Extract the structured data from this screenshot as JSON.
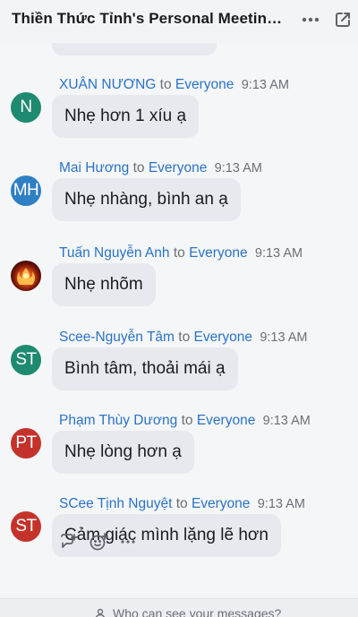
{
  "header": {
    "title": "Thiền Thức Tỉnh's Personal Meeting Room",
    "more_icon": "more-horizontal-icon",
    "popout_icon": "pop-out-icon"
  },
  "messages": [
    {
      "sender": "XUÂN NƯƠNG",
      "to": "to",
      "recipient": "Everyone",
      "time": "9:13 AM",
      "text": "Nhẹ hơn 1 xíu ạ",
      "avatar_initials": "N",
      "avatar_color": "#1e8a6f"
    },
    {
      "sender": "Mai Hương",
      "to": "to",
      "recipient": "Everyone",
      "time": "9:13 AM",
      "text": "Nhẹ nhàng, bình an ạ",
      "avatar_initials": "MH",
      "avatar_color": "#2f7fc3"
    },
    {
      "sender": "Tuấn Nguyễn Anh",
      "to": "to",
      "recipient": "Everyone",
      "time": "9:13 AM",
      "text": "Nhẹ nhõm",
      "avatar_initials": "",
      "avatar_color": "#7a1608"
    },
    {
      "sender": "Scee-Nguyễn Tâm",
      "to": "to",
      "recipient": "Everyone",
      "time": "9:13 AM",
      "text": "Bình tâm, thoải mái ạ",
      "avatar_initials": "ST",
      "avatar_color": "#1e8a6f"
    },
    {
      "sender": "Phạm Thùy Dương",
      "to": "to",
      "recipient": "Everyone",
      "time": "9:13 AM",
      "text": "Nhẹ lòng hơn ạ",
      "avatar_initials": "PT",
      "avatar_color": "#c4332b"
    },
    {
      "sender": "SCee Tịnh Nguyệt",
      "to": "to",
      "recipient": "Everyone",
      "time": "9:13 AM",
      "text": "Cảm giác mình lặng lẽ hơn",
      "avatar_initials": "ST",
      "avatar_color": "#c4332b"
    }
  ],
  "actions": {
    "reply_icon": "reply-thread-icon",
    "emoji_icon": "add-reaction-icon",
    "more_icon": "more-horizontal-icon"
  },
  "footer": {
    "text": "Who can see your messages?",
    "icon": "person-icon"
  },
  "colors": {
    "link": "#2a73c6",
    "bubble": "#e8e9ee",
    "background": "#f5f6f8"
  }
}
